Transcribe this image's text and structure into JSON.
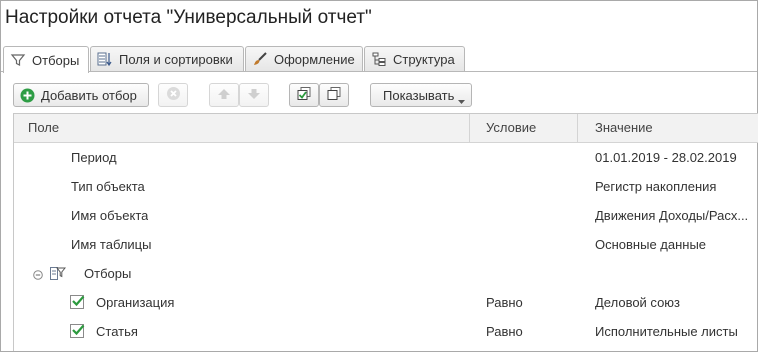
{
  "window": {
    "title": "Настройки отчета \"Универсальный отчет\""
  },
  "tabs": [
    {
      "label": "Отборы",
      "icon": "filter-icon",
      "active": true
    },
    {
      "label": "Поля и сортировки",
      "icon": "fields-sort-icon",
      "active": false
    },
    {
      "label": "Оформление",
      "icon": "brush-icon",
      "active": false
    },
    {
      "label": "Структура",
      "icon": "structure-icon",
      "active": false
    }
  ],
  "toolbar": {
    "add_filter_label": "Добавить отбор",
    "show_label": "Показывать"
  },
  "table": {
    "columns": [
      "Поле",
      "Условие",
      "Значение"
    ],
    "rows": [
      {
        "field": "Период",
        "condition": "",
        "value": "01.01.2019 - 28.02.2019"
      },
      {
        "field": "Тип объекта",
        "condition": "",
        "value": "Регистр накопления"
      },
      {
        "field": "Имя объекта",
        "condition": "",
        "value": "Движения Доходы/Расх..."
      },
      {
        "field": "Имя таблицы",
        "condition": "",
        "value": "Основные данные"
      },
      {
        "field": "Отборы",
        "condition": "",
        "value": "",
        "group": true
      },
      {
        "field": "Организация",
        "condition": "Равно",
        "value": "Деловой союз",
        "checked": true
      },
      {
        "field": "Статья",
        "condition": "Равно",
        "value": "Исполнительные листы",
        "checked": true
      }
    ]
  },
  "colors": {
    "accent_green": "#2e9d45",
    "check_green": "#2c9a3e"
  }
}
